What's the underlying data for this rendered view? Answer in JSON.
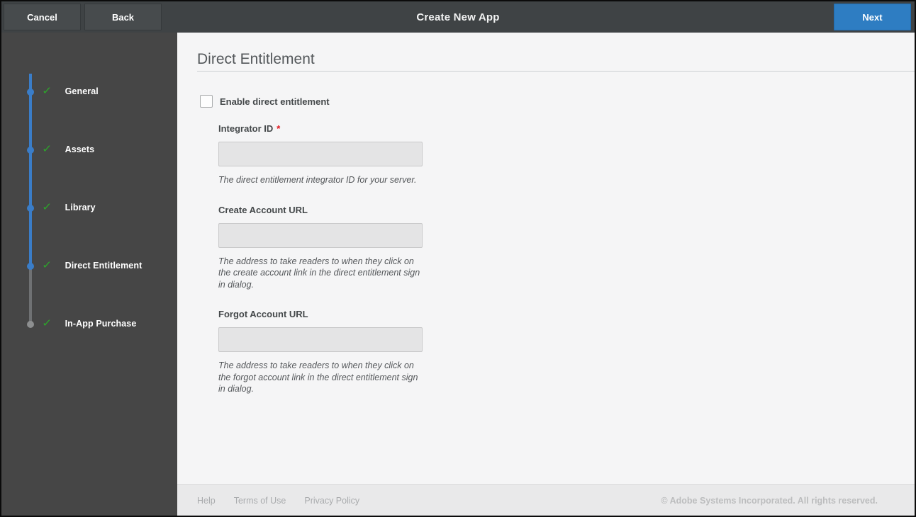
{
  "topbar": {
    "cancel_label": "Cancel",
    "back_label": "Back",
    "title": "Create New App",
    "next_label": "Next"
  },
  "icons": {
    "check": "✓"
  },
  "colors": {
    "accent_blue": "#2e7dc2",
    "stepper_blue": "#3a7dc8",
    "check_green": "#2da32b",
    "required_red": "#e0121a",
    "sidebar_bg": "#464646",
    "topbar_bg": "#3f4345",
    "content_bg": "#f5f5f6",
    "footer_bg": "#e9e9ea"
  },
  "sidebar": {
    "steps": [
      {
        "label": "General",
        "checked": true,
        "dot": "blue"
      },
      {
        "label": "Assets",
        "checked": true,
        "dot": "blue"
      },
      {
        "label": "Library",
        "checked": true,
        "dot": "blue"
      },
      {
        "label": "Direct Entitlement",
        "checked": true,
        "dot": "blue"
      },
      {
        "label": "In-App Purchase",
        "checked": true,
        "dot": "gray"
      }
    ]
  },
  "main": {
    "heading": "Direct Entitlement",
    "checkbox": {
      "label": "Enable direct entitlement",
      "checked": false
    },
    "fields": [
      {
        "label": "Integrator ID",
        "required_mark": "*",
        "value": "",
        "helper": "The direct entitlement integrator ID for your server."
      },
      {
        "label": "Create Account URL",
        "required_mark": "",
        "value": "",
        "helper": "The address to take readers to when they click on the create account link in the direct entitlement sign in dialog."
      },
      {
        "label": "Forgot Account URL",
        "required_mark": "",
        "value": "",
        "helper": "The address to take readers to when they click on the forgot account link in the direct entitlement sign in dialog."
      }
    ]
  },
  "footer": {
    "links": [
      "Help",
      "Terms of Use",
      "Privacy Policy"
    ],
    "copyright": "© Adobe Systems Incorporated. All rights reserved."
  }
}
